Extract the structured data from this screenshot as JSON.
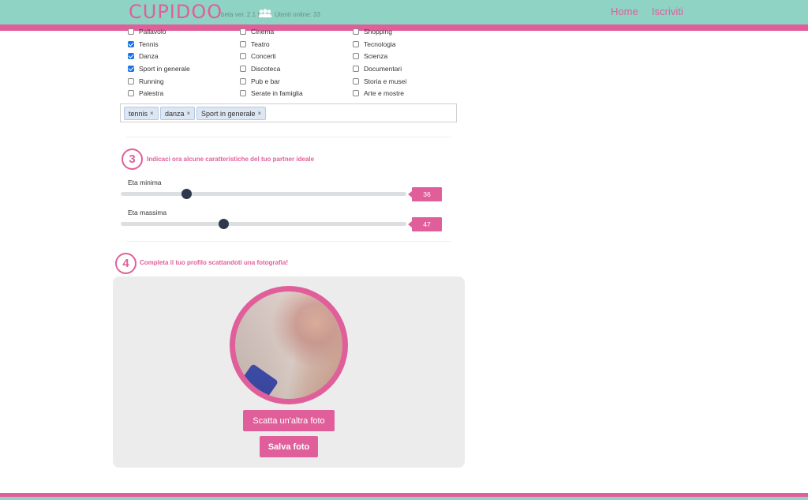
{
  "header": {
    "logo": "Cupidoo",
    "beta": "beta ver. 2.1 |",
    "online": "Utenti online: 33",
    "nav_home": "Home",
    "nav_join": "Iscriviti",
    "colors": {
      "header": "#8fd3c4",
      "accent": "#e05f9a"
    }
  },
  "interests": {
    "col1": [
      {
        "label": "Pallavolo",
        "checked": false
      },
      {
        "label": "Tennis",
        "checked": true
      },
      {
        "label": "Danza",
        "checked": true
      },
      {
        "label": "Sport in generale",
        "checked": true
      },
      {
        "label": "Running",
        "checked": false
      },
      {
        "label": "Palestra",
        "checked": false
      }
    ],
    "col2": [
      {
        "label": "Cinema",
        "checked": false
      },
      {
        "label": "Teatro",
        "checked": false
      },
      {
        "label": "Concerti",
        "checked": false
      },
      {
        "label": "Discoteca",
        "checked": false
      },
      {
        "label": "Pub e bar",
        "checked": false
      },
      {
        "label": "Serate in famiglia",
        "checked": false
      }
    ],
    "col3": [
      {
        "label": "Shopping",
        "checked": false
      },
      {
        "label": "Tecnologia",
        "checked": false
      },
      {
        "label": "Scienza",
        "checked": false
      },
      {
        "label": "Documentari",
        "checked": false
      },
      {
        "label": "Storia e musei",
        "checked": false
      },
      {
        "label": "Arte e mostre",
        "checked": false
      }
    ],
    "tags": [
      "tennis",
      "danza",
      "Sport in generale"
    ],
    "tag_remove": "×"
  },
  "step3": {
    "number": "3",
    "title": "Indicaci ora alcune caratteristiche del tuo partner ideale",
    "min_label": "Eta minima",
    "min_value": "36",
    "min_fraction": 0.228,
    "max_label": "Eta massima",
    "max_value": "47",
    "max_fraction": 0.358
  },
  "step4": {
    "number": "4",
    "title": "Completa il tuo profilo scattandoti una fotografia!",
    "retake_label": "Scatta un'altra foto",
    "save_label": "Salva foto"
  }
}
